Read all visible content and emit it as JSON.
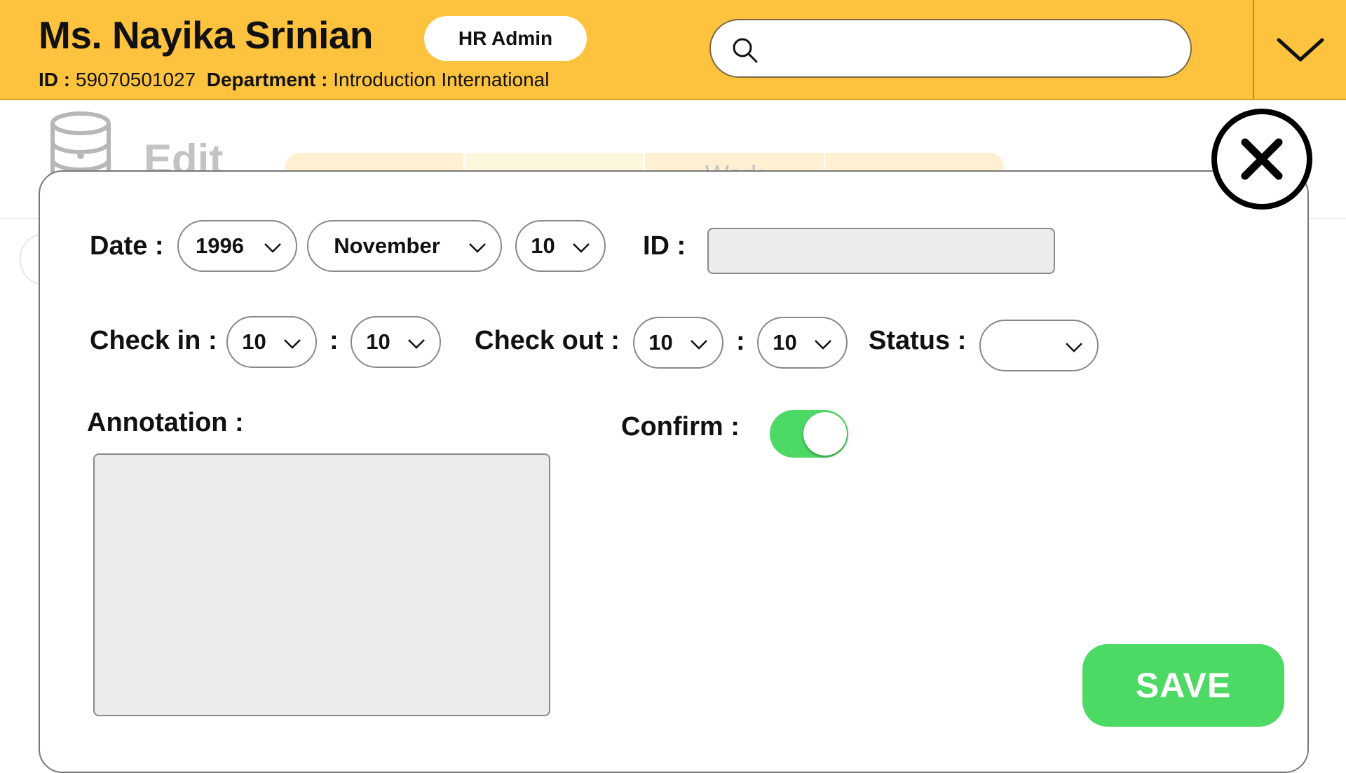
{
  "header": {
    "user_name": "Ms. Nayika Srinian",
    "role_badge": "HR Admin",
    "id_label": "ID :",
    "id_value": "59070501027",
    "department_label": "Department :",
    "department_value": "Introduction International",
    "search": {
      "value": "",
      "placeholder": ""
    },
    "background_color": "#fdc33e"
  },
  "background_page": {
    "title": "Edit",
    "tabs": [
      "",
      "",
      "Work",
      ""
    ]
  },
  "form": {
    "date_label": "Date :",
    "year": "1996",
    "month": "November",
    "day": "10",
    "id_label": "ID :",
    "id_value": "",
    "check_in_label": "Check in :",
    "check_in_hour": "10",
    "check_in_minute": "10",
    "time_separator": ":",
    "check_out_label": "Check out :",
    "check_out_hour": "10",
    "check_out_minute": "10",
    "status_label": "Status :",
    "status_value": "",
    "annotation_label": "Annotation :",
    "annotation_value": "",
    "confirm_label": "Confirm :",
    "confirm_on": true,
    "save_label": "SAVE"
  },
  "colors": {
    "accent_yellow": "#fdc33e",
    "toggle_green": "#4cd964",
    "save_green": "#4cd964",
    "field_gray": "#ececec"
  },
  "icons": [
    "search-icon",
    "chevron-down-icon",
    "close-icon",
    "database-icon",
    "plus-icon"
  ]
}
